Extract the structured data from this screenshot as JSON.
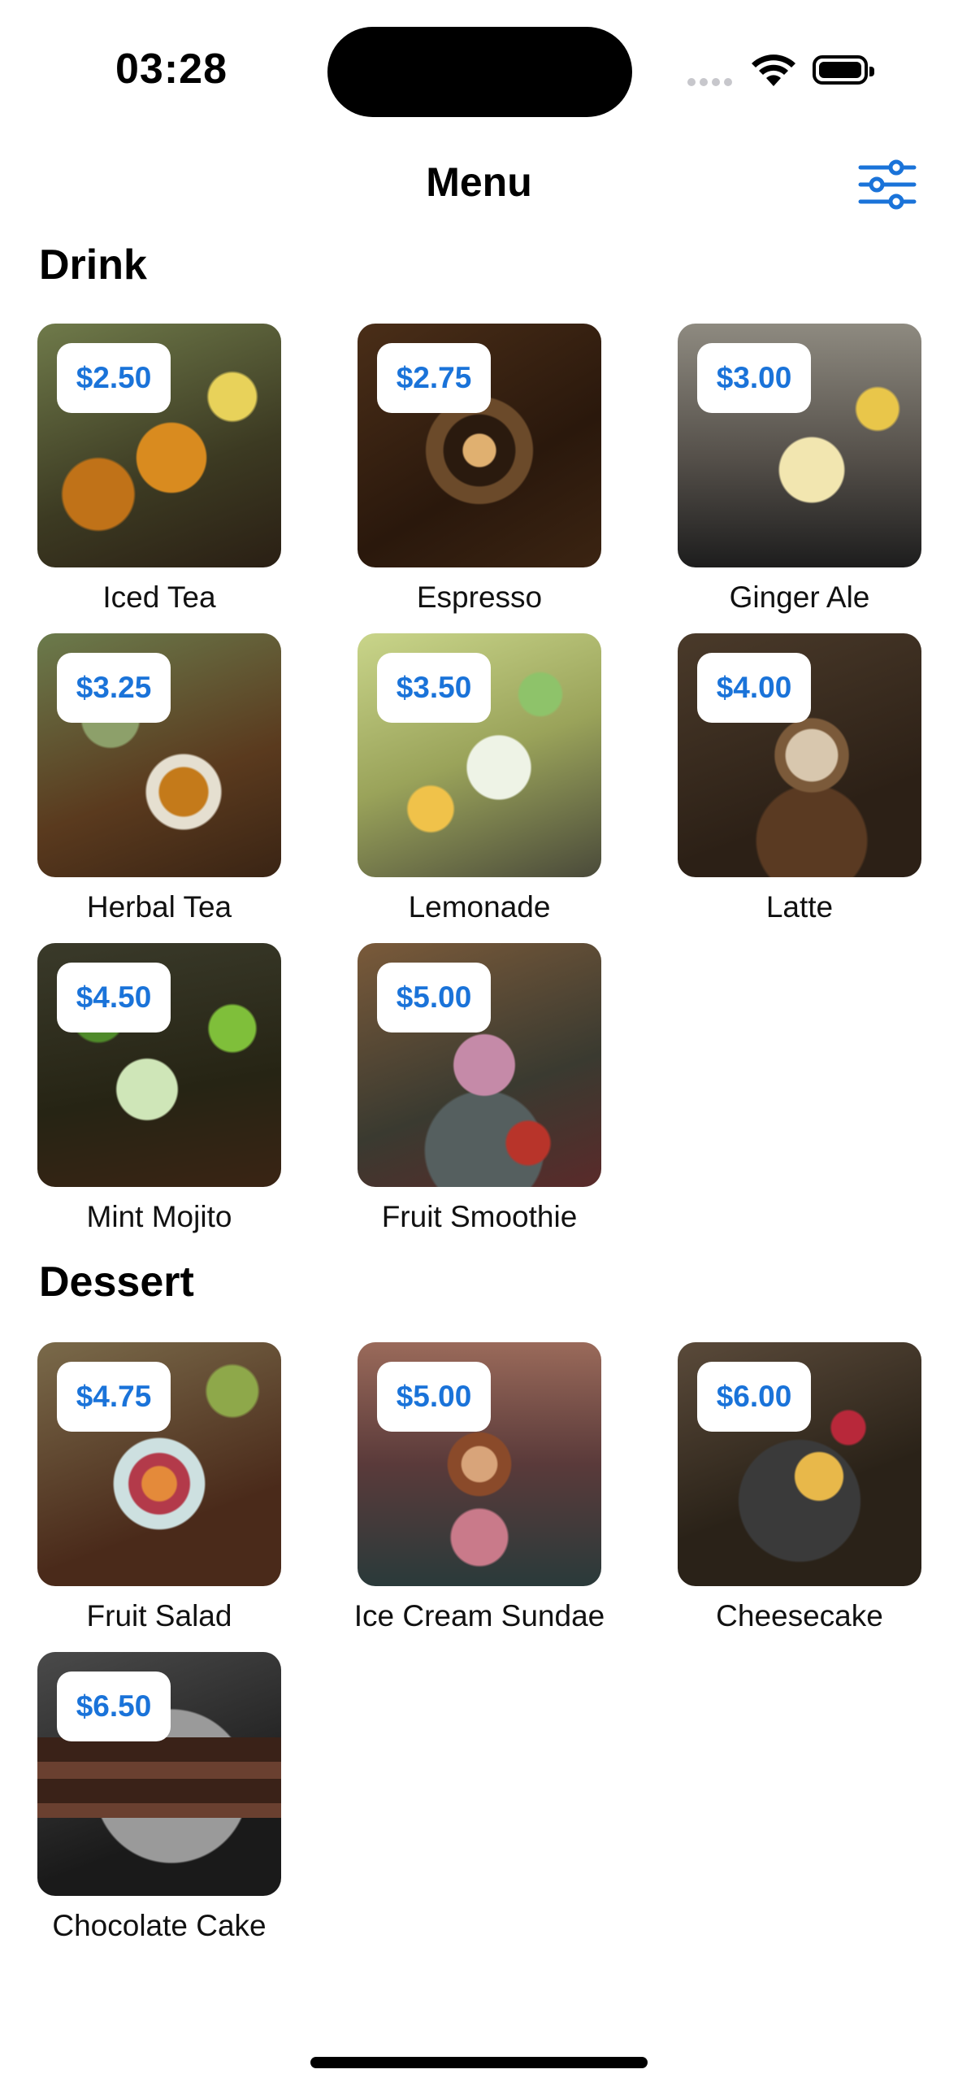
{
  "status_bar": {
    "time": "03:28"
  },
  "nav": {
    "title": "Menu",
    "filter_icon": "sliders-icon"
  },
  "colors": {
    "accent": "#1a73d9"
  },
  "sections": [
    {
      "title": "Drink",
      "items": [
        {
          "name": "Iced Tea",
          "price": "$2.50"
        },
        {
          "name": "Espresso",
          "price": "$2.75"
        },
        {
          "name": "Ginger Ale",
          "price": "$3.00"
        },
        {
          "name": "Herbal Tea",
          "price": "$3.25"
        },
        {
          "name": "Lemonade",
          "price": "$3.50"
        },
        {
          "name": "Latte",
          "price": "$4.00"
        },
        {
          "name": "Mint Mojito",
          "price": "$4.50"
        },
        {
          "name": "Fruit Smoothie",
          "price": "$5.00"
        }
      ]
    },
    {
      "title": "Dessert",
      "items": [
        {
          "name": "Fruit Salad",
          "price": "$4.75"
        },
        {
          "name": "Ice Cream Sundae",
          "price": "$5.00"
        },
        {
          "name": "Cheesecake",
          "price": "$6.00"
        },
        {
          "name": "Chocolate Cake",
          "price": "$6.50"
        }
      ]
    }
  ]
}
